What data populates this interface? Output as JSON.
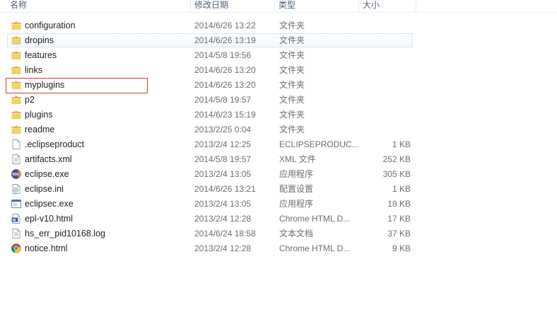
{
  "columns": {
    "name": "名称",
    "date": "修改日期",
    "type": "类型",
    "size": "大小"
  },
  "files": [
    {
      "name": "configuration",
      "date": "2014/6/26 13:22",
      "type": "文件夹",
      "size": "",
      "icon": "folder-icon"
    },
    {
      "name": "dropins",
      "date": "2014/6/26 13:19",
      "type": "文件夹",
      "size": "",
      "icon": "folder-icon"
    },
    {
      "name": "features",
      "date": "2014/5/8 19:56",
      "type": "文件夹",
      "size": "",
      "icon": "folder-icon"
    },
    {
      "name": "links",
      "date": "2014/6/26 13:20",
      "type": "文件夹",
      "size": "",
      "icon": "folder-icon"
    },
    {
      "name": "myplugins",
      "date": "2014/6/26 13:20",
      "type": "文件夹",
      "size": "",
      "icon": "folder-icon"
    },
    {
      "name": "p2",
      "date": "2014/5/8 19:57",
      "type": "文件夹",
      "size": "",
      "icon": "folder-icon"
    },
    {
      "name": "plugins",
      "date": "2014/6/23 15:19",
      "type": "文件夹",
      "size": "",
      "icon": "folder-icon"
    },
    {
      "name": "readme",
      "date": "2013/2/25 0:04",
      "type": "文件夹",
      "size": "",
      "icon": "folder-icon"
    },
    {
      "name": ".eclipseproduct",
      "date": "2013/2/4 12:25",
      "type": "ECLIPSEPRODUC...",
      "size": "1 KB",
      "icon": "blank-file-icon"
    },
    {
      "name": "artifacts.xml",
      "date": "2014/5/8 19:57",
      "type": "XML 文件",
      "size": "252 KB",
      "icon": "text-file-icon"
    },
    {
      "name": "eclipse.exe",
      "date": "2013/2/4 13:05",
      "type": "应用程序",
      "size": "305 KB",
      "icon": "eclipse-icon"
    },
    {
      "name": "eclipse.ini",
      "date": "2014/6/26 13:21",
      "type": "配置设置",
      "size": "1 KB",
      "icon": "settings-file-icon"
    },
    {
      "name": "eclipsec.exe",
      "date": "2013/2/4 13:05",
      "type": "应用程序",
      "size": "18 KB",
      "icon": "application-icon"
    },
    {
      "name": "epl-v10.html",
      "date": "2013/2/4 12:28",
      "type": "Chrome HTML D...",
      "size": "17 KB",
      "icon": "html-file-icon"
    },
    {
      "name": "hs_err_pid10168.log",
      "date": "2014/6/24 18:58",
      "type": "文本文档",
      "size": "37 KB",
      "icon": "text-file-icon"
    },
    {
      "name": "notice.html",
      "date": "2013/2/4 12:28",
      "type": "Chrome HTML D...",
      "size": "9 KB",
      "icon": "chrome-icon"
    }
  ],
  "hover_row": "dropins",
  "outlined_row": "myplugins"
}
